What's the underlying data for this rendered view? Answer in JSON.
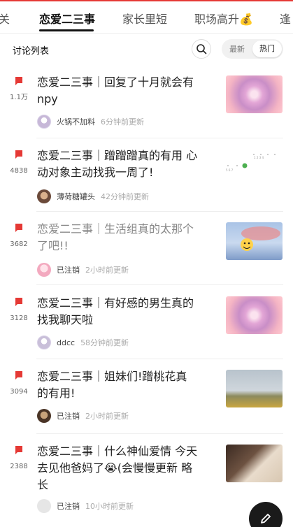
{
  "tabs": [
    {
      "label": "关"
    },
    {
      "label": "恋爱二三事"
    },
    {
      "label": "家长里短"
    },
    {
      "label": "职场高升💰"
    },
    {
      "label": "逢"
    }
  ],
  "section": {
    "title": "讨论列表",
    "sort_latest": "最新",
    "sort_hot": "热门"
  },
  "posts": [
    {
      "count": "1.1万",
      "title_line1": "恋爱二三事｜回复了十月就会有",
      "title_line2": "npy",
      "author": "火锅不加料",
      "time": "6分钟前更新"
    },
    {
      "count": "4838",
      "title_line1": "恋爱二三事｜蹭蹭蹭真的有用 心",
      "title_line2": "动对象主动找我一周了!",
      "author": "薄荷糖罐头",
      "time": "42分钟前更新"
    },
    {
      "count": "3682",
      "title_line1": "恋爱二三事｜生活组真的太那个",
      "title_line2": "了吧!!",
      "author": "已注销",
      "time": "2小时前更新"
    },
    {
      "count": "3128",
      "title_line1": "恋爱二三事｜有好感的男生真的",
      "title_line2": "找我聊天啦",
      "author": "ddcc",
      "time": "58分钟前更新"
    },
    {
      "count": "3094",
      "title_line1": "恋爱二三事｜姐妹们!蹭桃花真",
      "title_line2": "的有用!",
      "author": "已注销",
      "time": "2小时前更新"
    },
    {
      "count": "2388",
      "title_line1": "恋爱二三事｜什么神仙爱情 今天",
      "title_line2": "去见他爸妈了😭(会慢慢更新 略",
      "title_line3": "长",
      "author": "已注销",
      "time": "10小时前更新"
    }
  ],
  "colors": {
    "accent": "#e53935",
    "flag": "#e53935"
  },
  "icons": {
    "search": "search-icon",
    "vote": "flag-icon",
    "fab": "pencil-icon"
  }
}
